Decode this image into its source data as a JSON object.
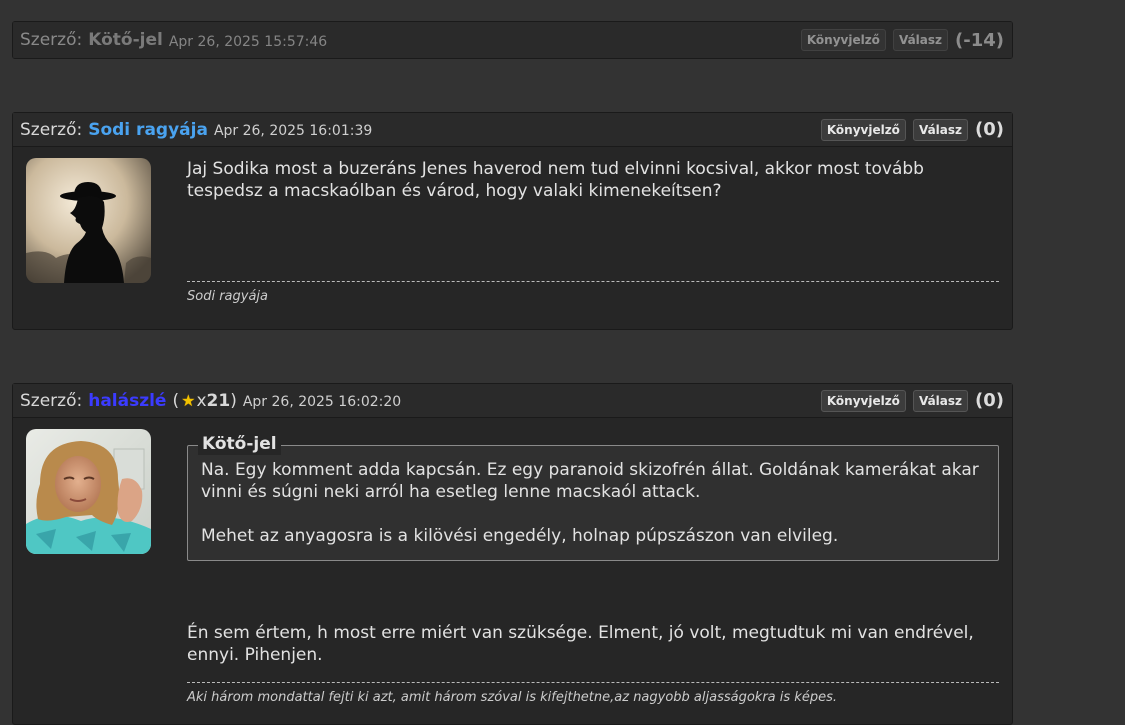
{
  "posts": [
    {
      "author_label": "Szerző:",
      "author": "Kötő-jel",
      "author_color": "#bdbdbd",
      "timestamp": "Apr 26, 2025 15:57:46",
      "bookmark_label": "Könyvjelző",
      "reply_label": "Válasz",
      "score": "(-14)",
      "collapsed": true
    },
    {
      "author_label": "Szerző:",
      "author": "Sodi ragyája",
      "author_color": "#4aa3f0",
      "timestamp": "Apr 26, 2025 16:01:39",
      "bookmark_label": "Könyvjelző",
      "reply_label": "Válasz",
      "score": "(0)",
      "avatar": "silhouette-with-hat",
      "body": "Jaj Sodika most a buzeráns Jenes haverod nem tud elvinni kocsival, akkor most tovább tespedsz a macskaólban és várod, hogy valaki kimenekeítsen?",
      "signature": "Sodi ragyája"
    },
    {
      "author_label": "Szerző:",
      "author": "halászlé",
      "author_color": "#3b3bff",
      "stars_open": "(",
      "star_icon": "star-icon",
      "stars_x": "x",
      "stars_count": "21",
      "stars_close": ")",
      "timestamp": "Apr 26, 2025 16:02:20",
      "bookmark_label": "Könyvjelző",
      "reply_label": "Válasz",
      "score": "(0)",
      "avatar": "woman-photo",
      "quote": {
        "author": "Kötő-jel",
        "paragraph1": "Na. Egy komment adda kapcsán. Ez egy paranoid skizofrén állat. Goldának kamerákat akar vinni és súgni neki arról ha esetleg lenne macskaól attack.",
        "paragraph2": "Mehet az anyagosra is a kilövési engedély, holnap púpszászon van elvileg."
      },
      "body": "Én sem értem, h most erre miért van szüksége. Elment, jó volt, megtudtuk mi van endrével, ennyi. Pihenjen.",
      "signature": "Aki három mondattal fejti ki azt, amit három szóval is kifejthetne,az nagyobb aljasságokra is képes."
    }
  ]
}
